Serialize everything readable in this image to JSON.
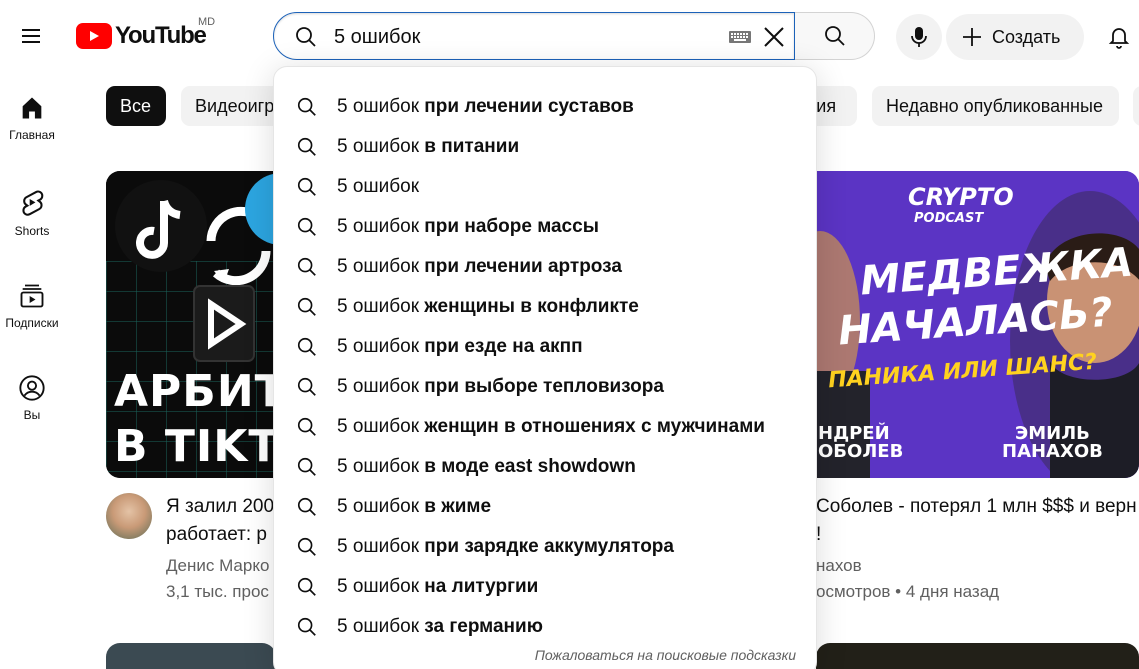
{
  "header": {
    "logo_text": "YouTube",
    "region": "MD",
    "search_value": "5 ошибок",
    "create_label": "Создать"
  },
  "rail": {
    "items": [
      {
        "label": "Главная",
        "icon": "home-icon"
      },
      {
        "label": "Shorts",
        "icon": "shorts-icon"
      },
      {
        "label": "Подписки",
        "icon": "subscriptions-icon"
      },
      {
        "label": "Вы",
        "icon": "you-icon"
      }
    ]
  },
  "chips": [
    {
      "label": "Все",
      "active": true
    },
    {
      "label": "Видеоигры",
      "active": false
    },
    {
      "label": "ция",
      "active": false
    },
    {
      "label": "Недавно опубликованные",
      "active": false
    }
  ],
  "suggestions": {
    "query": "5 ошибок",
    "items": [
      {
        "prefix": "5 ошибок",
        "suffix": " при лечении суставов"
      },
      {
        "prefix": "5 ошибок",
        "suffix": " в питании"
      },
      {
        "prefix": "5 ошибок",
        "suffix": ""
      },
      {
        "prefix": "5 ошибок",
        "suffix": " при наборе массы"
      },
      {
        "prefix": "5 ошибок",
        "suffix": " при лечении артроза"
      },
      {
        "prefix": "5 ошибок",
        "suffix": " женщины в конфликте"
      },
      {
        "prefix": "5 ошибок",
        "suffix": " при езде на акпп"
      },
      {
        "prefix": "5 ошибок",
        "suffix": " при выборе тепловизора"
      },
      {
        "prefix": "5 ошибок",
        "suffix": " женщин в отношениях с мужчинами"
      },
      {
        "prefix": "5 ошибок",
        "suffix": " в моде east showdown"
      },
      {
        "prefix": "5 ошибок",
        "suffix": " в жиме"
      },
      {
        "prefix": "5 ошибок",
        "suffix": " при зарядке аккумулятора"
      },
      {
        "prefix": "5 ошибок",
        "suffix": " на литургии"
      },
      {
        "prefix": "5 ошибок",
        "suffix": " за германию"
      }
    ],
    "report_label": "Пожаловаться на поисковые подсказки"
  },
  "videos": [
    {
      "thumb_text_1": "АРБИТ",
      "thumb_text_2": "В TIKTO",
      "title_line1": "Я залил 200",
      "title_line2": "работает: р",
      "channel": "Денис Марко",
      "meta": "3,1 тыс. прос"
    },
    {
      "thumb_brand": "CRYPTO",
      "thumb_brand_sub": "PODCAST",
      "thumb_headline_1": "МЕДВЕЖКА",
      "thumb_headline_2": "НАЧАЛАСЬ?",
      "thumb_sub": "ПАНИКА ИЛИ ШАНС?",
      "thumb_name_left_1": "НДРЕЙ",
      "thumb_name_left_2": "ОБОЛЕВ",
      "thumb_name_right_1": "ЭМИЛЬ",
      "thumb_name_right_2": "ПАНАХОВ",
      "title_line1": "Соболев - потерял 1 млн $$$ и верн",
      "title_line2": "!",
      "channel": "нахов",
      "meta": "осмотров • 4 дня назад"
    }
  ]
}
